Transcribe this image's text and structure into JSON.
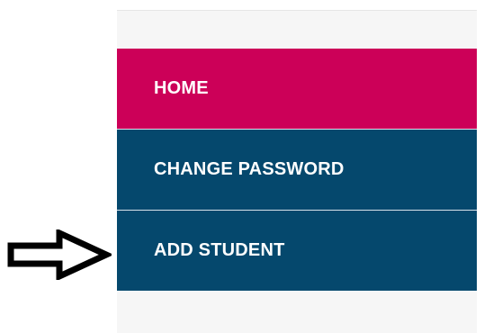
{
  "menu": {
    "items": [
      {
        "label": "HOME",
        "color": "#cc0058"
      },
      {
        "label": "CHANGE PASSWORD",
        "color": "#05486d"
      },
      {
        "label": "ADD STUDENT",
        "color": "#05486d"
      }
    ]
  },
  "annotation": {
    "icon": "right-arrow-outline-icon",
    "color": "#000000"
  }
}
